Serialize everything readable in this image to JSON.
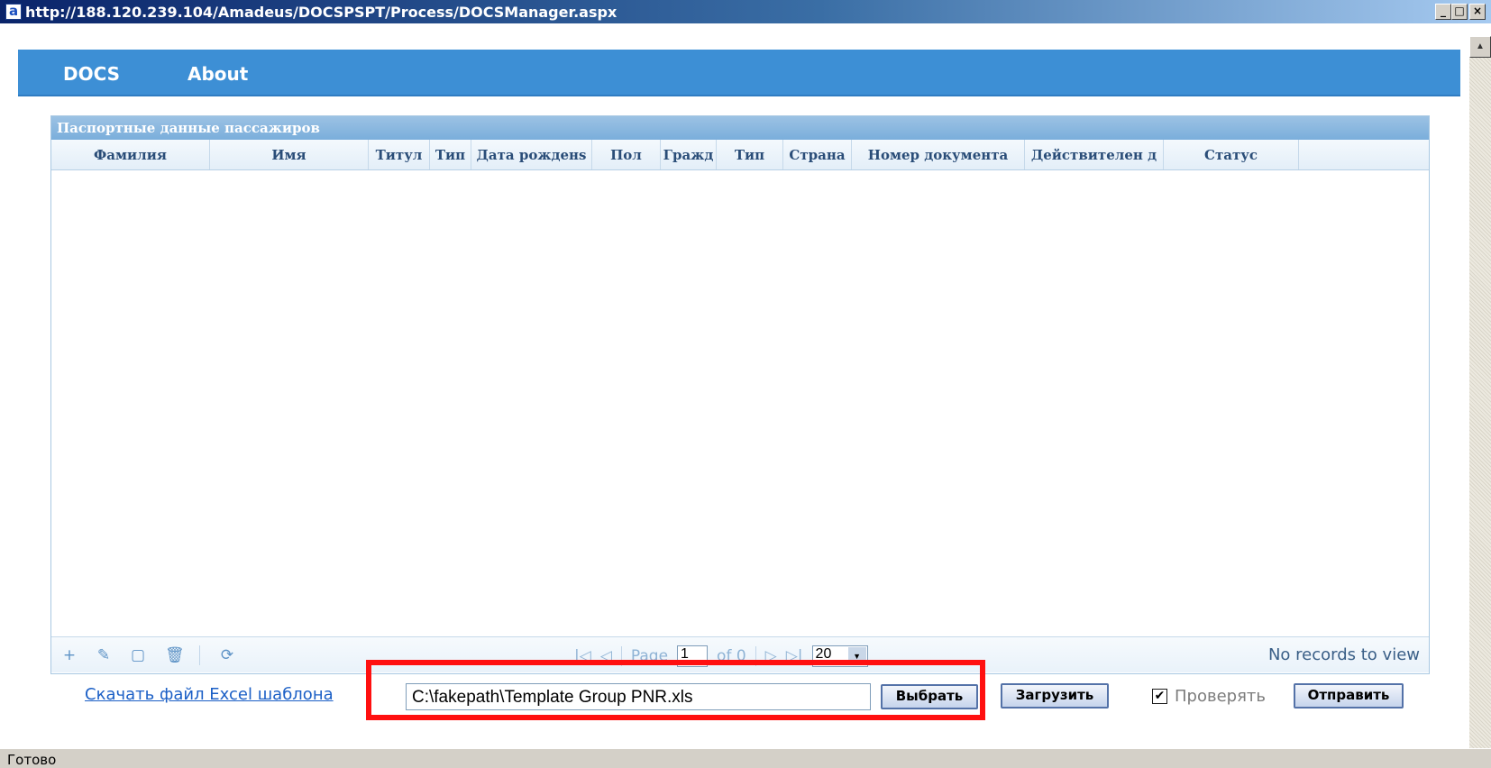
{
  "window": {
    "icon_glyph": "a",
    "title": "http://188.120.239.104/Amadeus/DOCSPSPT/Process/DOCSManager.aspx",
    "controls": [
      "_",
      "□",
      "×"
    ]
  },
  "nav": {
    "items": [
      {
        "label": "DOCS"
      },
      {
        "label": "About"
      }
    ]
  },
  "grid": {
    "caption": "Паспортные данные пассажиров",
    "columns": [
      "Фамилия",
      "Имя",
      "Титул",
      "Тип",
      "Дата рожденs",
      "Пол",
      "Гражд",
      "Тип",
      "Страна",
      "Номер документа",
      "Действителен д",
      "Статус"
    ],
    "rows": []
  },
  "pager": {
    "icons": [
      "plus-icon",
      "pencil-icon",
      "document-icon",
      "trash-icon",
      "refresh-icon"
    ],
    "page_label": "Page",
    "page_value": "1",
    "of_label": "of 0",
    "rows_per_page": "20",
    "records_text": "No records to view"
  },
  "upload": {
    "excel_link": "Скачать файл Excel шаблона",
    "file_path": "C:\\fakepath\\Template Group PNR.xls",
    "choose_label": "Выбрать",
    "upload_label": "Загрузить",
    "check_label": "Проверять",
    "check_glyph": "✔",
    "send_label": "Отправить"
  },
  "status": {
    "text": "Готово"
  },
  "colors": {
    "header_blue": "#3d8fd5",
    "highlight": "#ff1010"
  }
}
